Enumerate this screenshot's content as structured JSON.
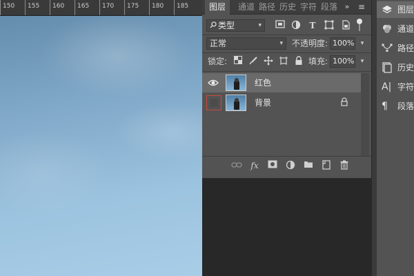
{
  "ruler": {
    "ticks": [
      "150",
      "155",
      "160",
      "165",
      "170",
      "175",
      "180",
      "185"
    ]
  },
  "layers_panel": {
    "tabs": [
      {
        "label": "图层",
        "active": true
      },
      {
        "label": "通道",
        "active": false
      },
      {
        "label": "路径",
        "active": false
      },
      {
        "label": "历史",
        "active": false
      },
      {
        "label": "字符",
        "active": false
      },
      {
        "label": "段落",
        "active": false
      }
    ],
    "more_label": "»",
    "menu_label": "≡",
    "filter": {
      "label": "类型",
      "icon": "search-icon"
    },
    "blend_mode": "正常",
    "opacity_label": "不透明度:",
    "opacity_value": "100%",
    "lock_label": "锁定:",
    "fill_label": "填充:",
    "fill_value": "100%",
    "layers": [
      {
        "name": "红色",
        "visible": true,
        "selected": true,
        "locked": false
      },
      {
        "name": "背景",
        "visible": false,
        "selected": false,
        "locked": true
      }
    ],
    "footer": {
      "fx_label": "fx"
    }
  },
  "right_panel": {
    "items": [
      {
        "label": "图层",
        "icon": "layers-icon",
        "active": true
      },
      {
        "label": "通道",
        "icon": "channels-icon",
        "active": false
      },
      {
        "label": "路径",
        "icon": "paths-icon",
        "active": false
      },
      {
        "label": "历史",
        "icon": "history-icon",
        "active": false
      },
      {
        "label": "字符",
        "icon": "character-icon",
        "active": false
      },
      {
        "label": "段落",
        "icon": "paragraph-icon",
        "active": false
      }
    ]
  },
  "colors": {
    "panel": "#535353",
    "selected_row": "#6a6a6a",
    "highlight_box": "#c94a3c",
    "sky": "#8fb9d9"
  }
}
